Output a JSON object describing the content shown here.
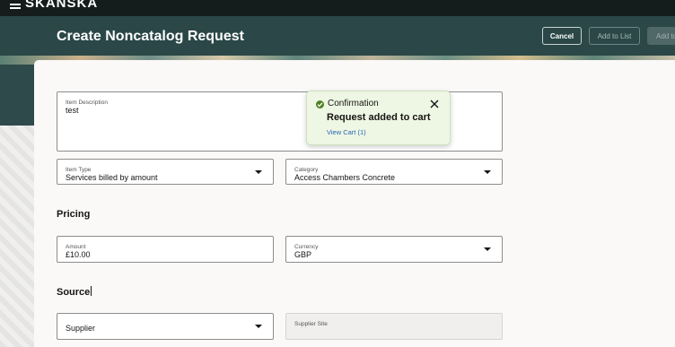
{
  "app": {
    "brand": "SKANSKA"
  },
  "header": {
    "title": "Create Noncatalog Request",
    "cancel_label": "Cancel",
    "add_to_list_label": "Add to List",
    "add_label": "Add to"
  },
  "form": {
    "item_description": {
      "label": "Item Description",
      "value": "test"
    },
    "item_type": {
      "label": "Item Type",
      "value": "Services billed by amount"
    },
    "category": {
      "label": "Category",
      "value": "Access Chambers Concrete"
    },
    "pricing_heading": "Pricing",
    "amount": {
      "label": "Amount",
      "value": "£10.00"
    },
    "currency": {
      "label": "Currency",
      "value": "GBP"
    },
    "source_heading": "Source",
    "supplier": {
      "value": "Supplier"
    },
    "supplier_site": {
      "label": "Supplier Site"
    }
  },
  "toast": {
    "title": "Confirmation",
    "message": "Request added to cart",
    "link": "View Cart (1)"
  },
  "colors": {
    "header": "#2b4747",
    "success": "#508223",
    "link": "#2467b1"
  }
}
